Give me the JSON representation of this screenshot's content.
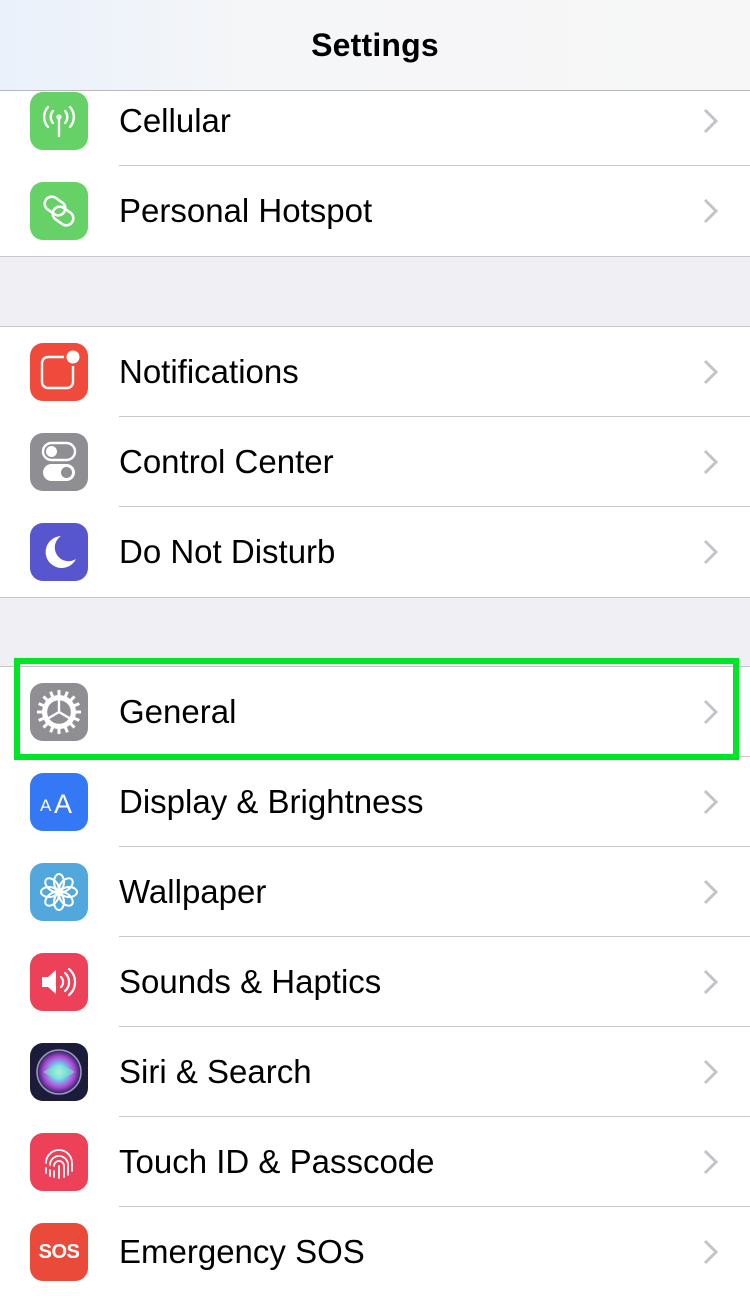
{
  "navbar": {
    "title": "Settings"
  },
  "groups": [
    {
      "items": [
        {
          "label": "Cellular",
          "icon": "antenna-icon",
          "color": "#65d166"
        },
        {
          "label": "Personal Hotspot",
          "icon": "chain-link-icon",
          "color": "#65d166"
        }
      ]
    },
    {
      "items": [
        {
          "label": "Notifications",
          "icon": "notification-badge-icon",
          "color": "#ef4a3c"
        },
        {
          "label": "Control Center",
          "icon": "toggle-switches-icon",
          "color": "#8e8e93"
        },
        {
          "label": "Do Not Disturb",
          "icon": "crescent-moon-icon",
          "color": "#5756ce"
        }
      ]
    },
    {
      "items": [
        {
          "label": "General",
          "icon": "gear-icon",
          "color": "#8e8e93",
          "highlighted": true
        },
        {
          "label": "Display & Brightness",
          "icon": "text-size-aa-icon",
          "color": "#3478f6"
        },
        {
          "label": "Wallpaper",
          "icon": "flower-icon",
          "color": "#52a8dc"
        },
        {
          "label": "Sounds & Haptics",
          "icon": "speaker-icon",
          "color": "#ec4159"
        },
        {
          "label": "Siri & Search",
          "icon": "siri-icon",
          "color": "#1b1b3a"
        },
        {
          "label": "Touch ID & Passcode",
          "icon": "fingerprint-icon",
          "color": "#ec4159"
        },
        {
          "label": "Emergency SOS",
          "icon": "sos-icon",
          "color": "#ea4a3a",
          "icon_text": "SOS"
        }
      ]
    }
  ],
  "highlight_color": "#00e626"
}
